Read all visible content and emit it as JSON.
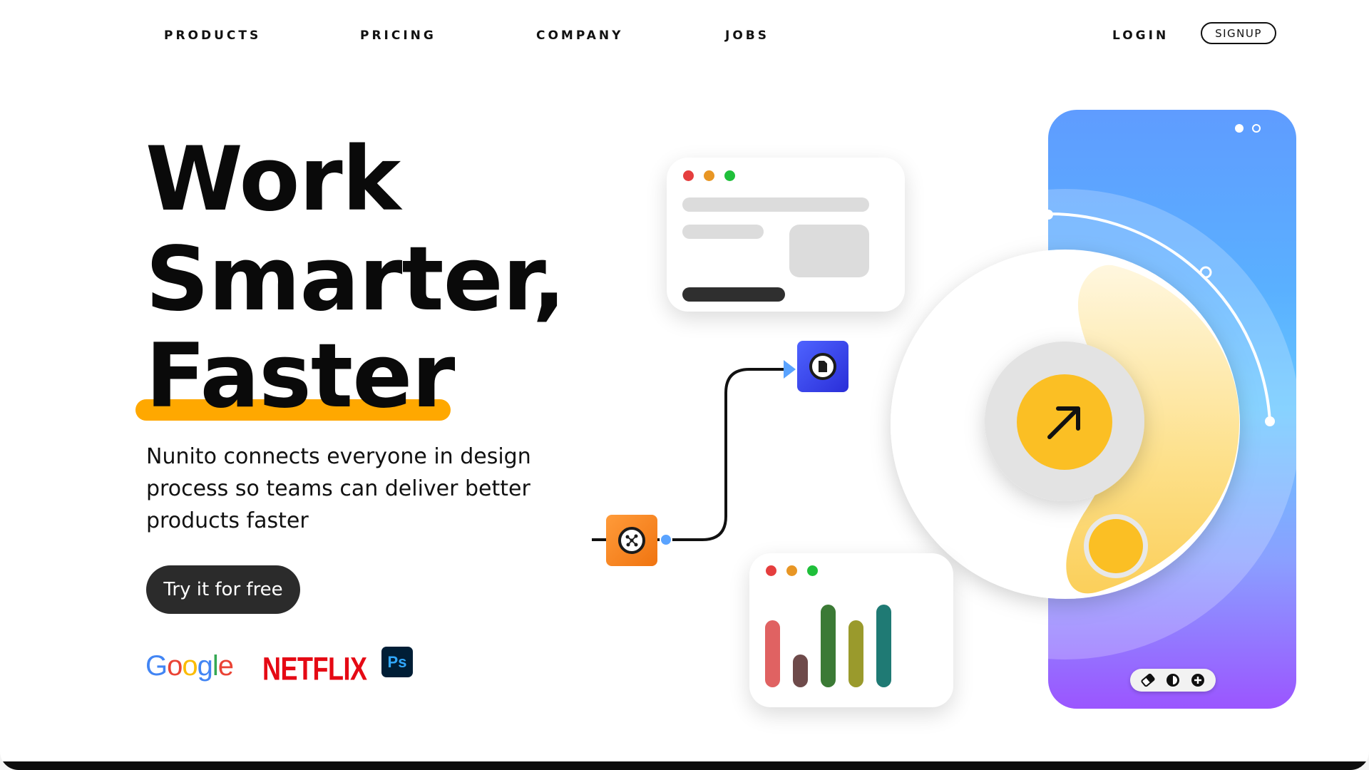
{
  "nav": {
    "links": [
      "PRODUCTS",
      "PRICING",
      "COMPANY",
      "JOBS"
    ],
    "login": "LOGIN",
    "signup": "SIGNUP"
  },
  "hero": {
    "title_lines": [
      "Work",
      "Smarter,",
      "Faster"
    ],
    "subtitle": "Nunito connects everyone in design process so teams can deliver better products faster",
    "cta": "Try it for free"
  },
  "logos": {
    "google": "Google",
    "netflix": "NETFLIX",
    "photoshop": "Ps"
  },
  "chart_card": {
    "bar_colors": [
      "#e06262",
      "#6e4a4a",
      "#3b7a35",
      "#9a9a2c",
      "#1f7a74"
    ],
    "bar_levels": [
      0.81,
      0.4,
      1.0,
      0.81,
      1.0
    ]
  },
  "colors": {
    "accent": "#ffa800",
    "knob": "#fbbf24",
    "window_red": "#e53e3e",
    "window_orange": "#e89624",
    "window_green": "#1fbf3a"
  },
  "icons": {
    "connector_start": "network-icon",
    "connector_end": "document-icon",
    "knob_arrow": "arrow-up-right-icon",
    "toolbar": [
      "eraser-icon",
      "contrast-icon",
      "plus-icon"
    ]
  }
}
